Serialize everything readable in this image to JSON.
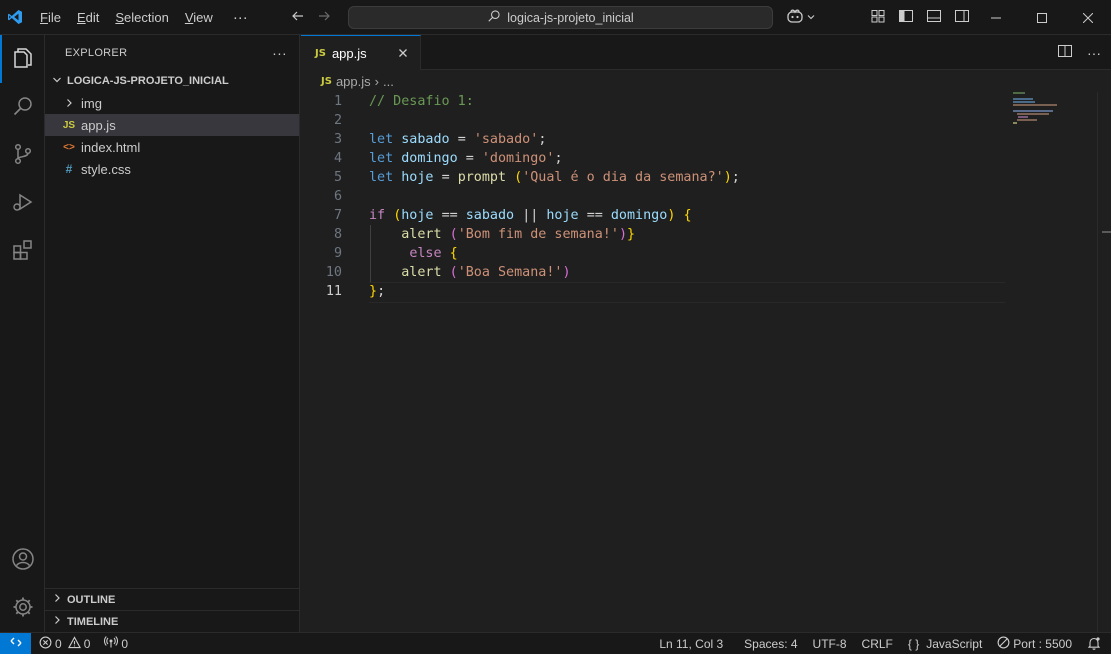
{
  "titlebar": {
    "menu": [
      {
        "label": "File",
        "key": "F",
        "rest": "ile"
      },
      {
        "label": "Edit",
        "key": "E",
        "rest": "dit"
      },
      {
        "label": "Selection",
        "key": "S",
        "rest": "election"
      },
      {
        "label": "View",
        "key": "V",
        "rest": "iew"
      }
    ],
    "more": "···",
    "search_text": "logica-js-projeto_inicial"
  },
  "sidebar": {
    "title": "EXPLORER",
    "more": "···",
    "folder": "LOGICA-JS-PROJETO_INICIAL",
    "items": [
      {
        "label": "img",
        "icon": "chevron-right-icon"
      },
      {
        "label": "app.js",
        "icon": "js-file-icon",
        "icon_text": "JS"
      },
      {
        "label": "index.html",
        "icon": "html-file-icon",
        "icon_text": "<>"
      },
      {
        "label": "style.css",
        "icon": "css-file-icon",
        "icon_text": "#"
      }
    ],
    "outline": "OUTLINE",
    "timeline": "TIMELINE"
  },
  "editor": {
    "tab": {
      "icon_text": "JS",
      "label": "app.js"
    },
    "breadcrumb": {
      "file": "app.js",
      "sep": "›",
      "more": "..."
    },
    "lines": [
      "1",
      "2",
      "3",
      "4",
      "5",
      "6",
      "7",
      "8",
      "9",
      "10",
      "11"
    ],
    "current_line": 11
  },
  "statusbar": {
    "errors": "0",
    "warnings": "0",
    "ports": "0",
    "position": "Ln 11, Col 3",
    "spaces": "Spaces: 4",
    "encoding": "UTF-8",
    "eol": "CRLF",
    "language_icon": "{ }",
    "language": "JavaScript",
    "port": "Port : 5500"
  },
  "colors": {
    "accent": "#0078d4",
    "background": "#1f1f1f",
    "sidebar": "#181818"
  }
}
